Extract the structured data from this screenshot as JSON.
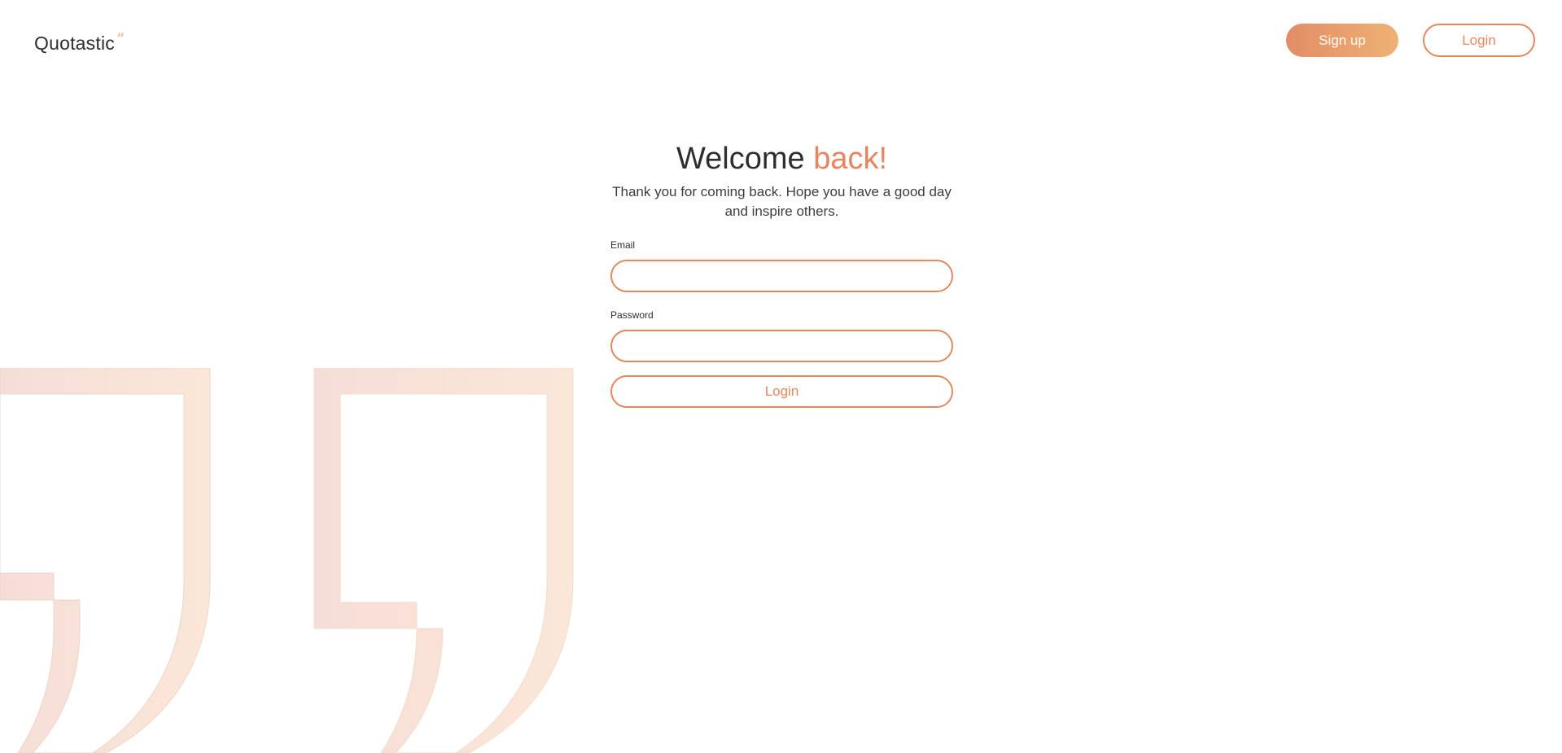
{
  "header": {
    "logo_text": "Quotastic",
    "logo_mark": "”",
    "signup_label": "Sign up",
    "login_label": "Login"
  },
  "main": {
    "title_prefix": "Welcome",
    "title_accent": "back!",
    "subtitle": "Thank you for coming back. Hope you have a good day and inspire others.",
    "email_label": "Email",
    "email_value": "",
    "password_label": "Password",
    "password_value": "",
    "submit_label": "Login"
  },
  "colors": {
    "accent": "#e5875f",
    "gradient_start": "#e38c66",
    "gradient_end": "#efb273",
    "text_dark": "#2e2e2e",
    "quote_bg_start": "#f5ddd5",
    "quote_bg_end": "#fbe6d6"
  },
  "icons": {
    "logo_mark": "quote-mark-icon",
    "background": "closing-quote-icon"
  }
}
